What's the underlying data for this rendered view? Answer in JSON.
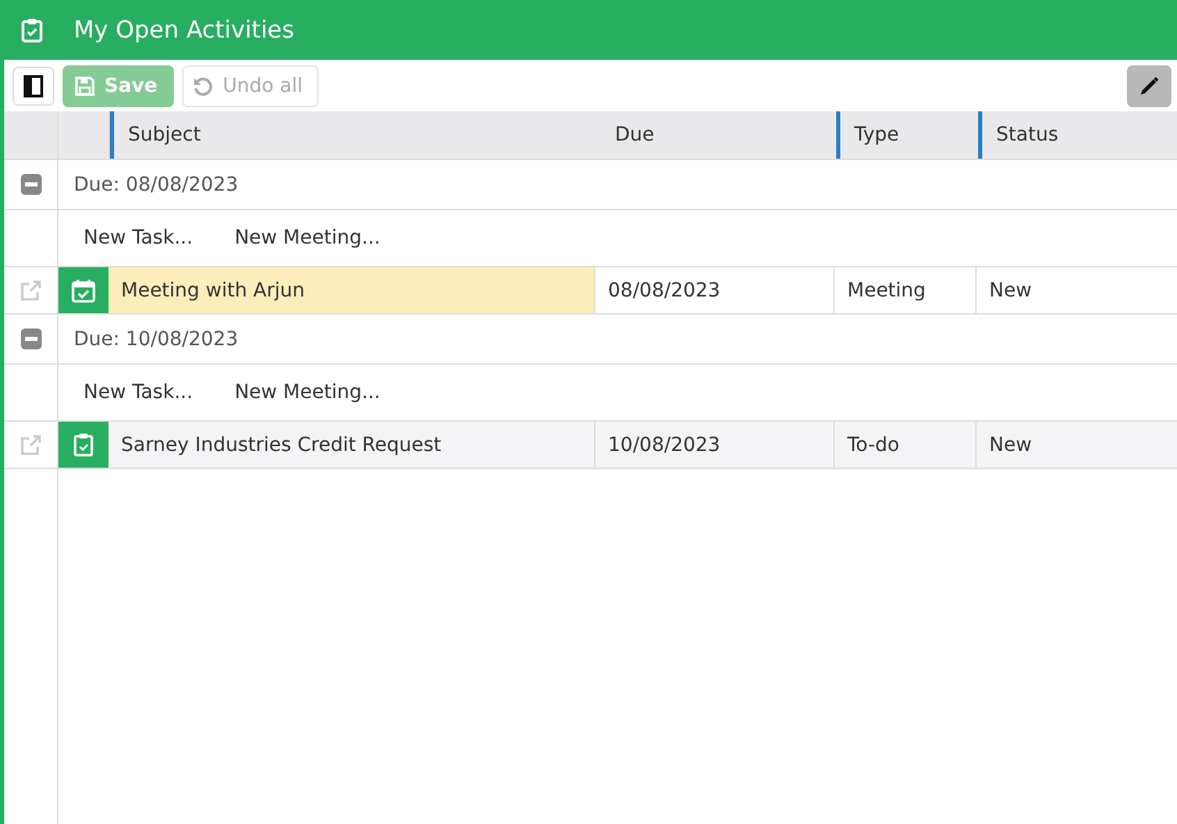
{
  "window": {
    "title": "My Open Activities"
  },
  "toolbar": {
    "buttons": [
      {
        "kind": "save",
        "label": "Save",
        "disabled": true
      },
      {
        "kind": "undo",
        "label": "Undo all",
        "disabled": true
      }
    ]
  },
  "table": {
    "columns": [
      {
        "label": "Subject",
        "accent": true
      },
      {
        "label": "Due",
        "accent": false
      },
      {
        "label": "Type",
        "accent": true
      },
      {
        "label": "Status",
        "accent": true
      }
    ],
    "groups": [
      {
        "label": "Due: 08/08/2023",
        "expanded": true,
        "actions": [
          "New Task...",
          "New Meeting..."
        ],
        "rows": [
          {
            "kind": "meeting",
            "subject": "Meeting with Arjun",
            "due": "08/08/2023",
            "type": "Meeting",
            "status": "New",
            "selected": true
          }
        ]
      },
      {
        "label": "Due: 10/08/2023",
        "expanded": true,
        "actions": [
          "New Task...",
          "New Meeting..."
        ],
        "rows": [
          {
            "kind": "task",
            "subject": "Sarney Industries Credit Request",
            "due": "10/08/2023",
            "type": "To-do",
            "status": "New",
            "selected": false
          }
        ]
      }
    ]
  }
}
